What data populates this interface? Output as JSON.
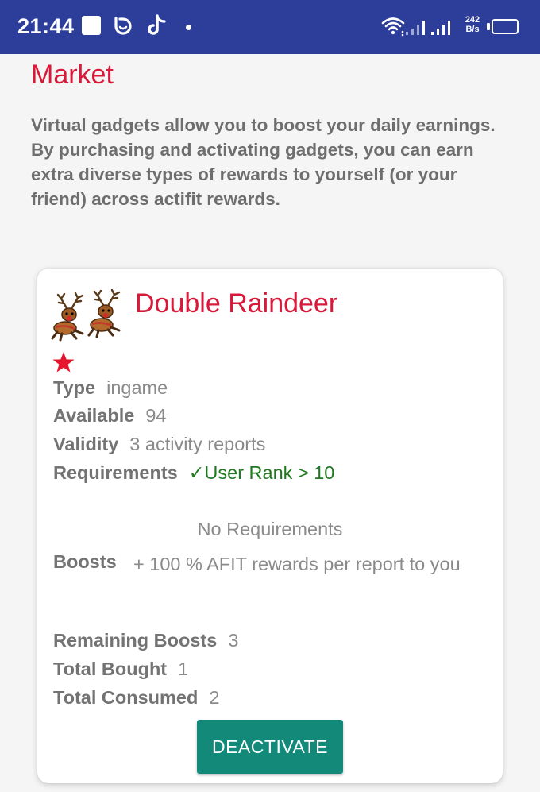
{
  "status_bar": {
    "time": "21:44",
    "net_speed_value": "242",
    "net_speed_unit": "B/s",
    "battery": "85",
    "battery_level": 0.85,
    "icons": [
      "square-notification-icon",
      "circle-app-icon",
      "tiktok-icon",
      "wifi-icon",
      "signal-icon",
      "signal-icon"
    ]
  },
  "market": {
    "title": "Market",
    "description": "Virtual gadgets allow you to boost your daily earnings. By purchasing and activating gadgets, you can earn extra diverse types of rewards to yourself (or your friend) across actifit rewards."
  },
  "gadget": {
    "name": "Double Raindeer",
    "icons": [
      "reindeer-icon",
      "reindeer-icon",
      "star-icon"
    ],
    "type_label": "Type",
    "type_value": "ingame",
    "available_label": "Available",
    "available_value": "94",
    "validity_label": "Validity",
    "validity_value": "3 activity reports",
    "requirements_label": "Requirements",
    "requirements_value": "✓User Rank > 10",
    "no_requirements": "No Requirements",
    "boosts_label": "Boosts",
    "boosts_value": "+ 100 % AFIT rewards per report to you",
    "remaining_label": "Remaining Boosts",
    "remaining_value": "3",
    "bought_label": "Total Bought",
    "bought_value": "1",
    "consumed_label": "Total Consumed",
    "consumed_value": "2",
    "button_label": "DEACTIVATE"
  },
  "colors": {
    "status_bar": "#2c3e9a",
    "title_red": "#d9193a",
    "button_teal": "#13897a",
    "requirement_green": "#1f7a1f"
  }
}
